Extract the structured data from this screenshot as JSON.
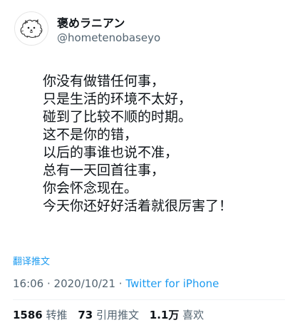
{
  "profile": {
    "display_name": "褒めラニアン",
    "handle": "@hometenobaseyo",
    "avatar_icon": "pomeranian-avatar-icon"
  },
  "tweet": {
    "lines": [
      "你没有做错任何事，",
      "只是生活的环境不太好，",
      "碰到了比较不顺的时期。",
      "这不是你的错，",
      "以后的事谁也说不准，",
      "总有一天回首往事，",
      "你会怀念现在。",
      "今天你还好好活着就很厉害了！"
    ]
  },
  "translate_label": "翻译推文",
  "meta": {
    "time": "16:06",
    "separator1": " · ",
    "date": "2020/10/21",
    "separator2": " · ",
    "source": "Twitter for iPhone"
  },
  "stats": {
    "retweets_count": "1586",
    "retweets_label": "转推",
    "quotes_count": "73",
    "quotes_label": "引用推文",
    "likes_count": "1.1万",
    "likes_label": "喜欢"
  },
  "colors": {
    "accent": "#1d9bf0",
    "text_primary": "#0f1419",
    "text_secondary": "#536471"
  }
}
